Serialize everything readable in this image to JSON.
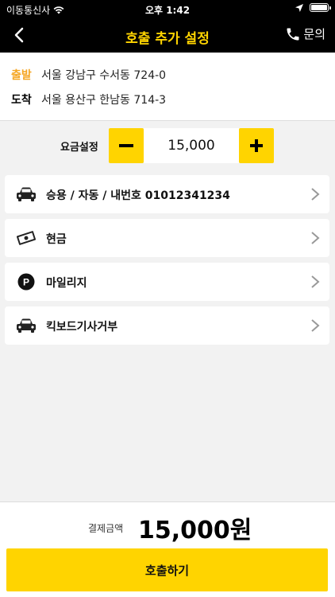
{
  "status_bar": {
    "carrier": "이동통신사",
    "time": "오후 1:42",
    "icons": [
      "wifi-icon",
      "location-arrow-icon",
      "battery-icon"
    ]
  },
  "nav": {
    "title": "호출 추가 설정",
    "inquiry_label": "문의",
    "back_icon": "chevron-left-icon",
    "inquiry_icon": "phone-icon",
    "accent_color": "#ffd400"
  },
  "route": {
    "departure_label": "출발",
    "departure_address": "서울 강남구 수서동 724-0",
    "arrival_label": "도착",
    "arrival_address": "서울 용산구 한남동 714-3"
  },
  "fare": {
    "label": "요금설정",
    "value": "15,000"
  },
  "options": [
    {
      "label": "승용 / 자동 / 내번호 01012341234",
      "icon": "car-icon"
    },
    {
      "label": "현금",
      "icon": "cash-icon"
    },
    {
      "label": "마일리지",
      "icon": "mileage-p-icon",
      "icon_text": "P"
    },
    {
      "label": "킥보드기사거부",
      "icon": "car-icon"
    }
  ],
  "payment": {
    "label": "결제금액",
    "amount": "15,000원"
  },
  "call_button": "호출하기"
}
